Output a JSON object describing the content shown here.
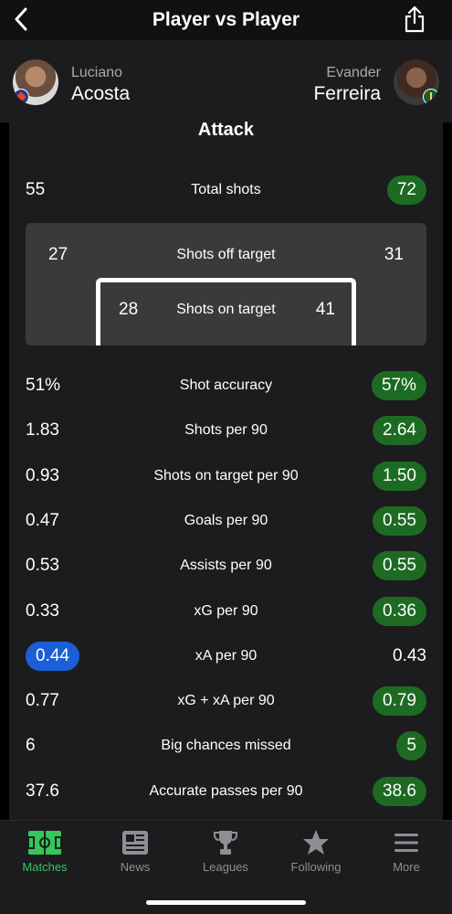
{
  "header": {
    "title": "Player vs Player"
  },
  "players": {
    "left": {
      "first": "Luciano",
      "last": "Acosta"
    },
    "right": {
      "first": "Evander",
      "last": "Ferreira"
    }
  },
  "section": {
    "title": "Attack"
  },
  "total_shots": {
    "label": "Total shots",
    "left": "55",
    "right": "72"
  },
  "shots_off_target": {
    "label": "Shots off target",
    "left": "27",
    "right": "31"
  },
  "shots_on_target": {
    "label": "Shots on target",
    "left": "28",
    "right": "41"
  },
  "stats": [
    {
      "label": "Shot accuracy",
      "left": "51%",
      "right": "57%",
      "highlight": "right"
    },
    {
      "label": "Shots per 90",
      "left": "1.83",
      "right": "2.64",
      "highlight": "right"
    },
    {
      "label": "Shots on target per 90",
      "left": "0.93",
      "right": "1.50",
      "highlight": "right"
    },
    {
      "label": "Goals per 90",
      "left": "0.47",
      "right": "0.55",
      "highlight": "right"
    },
    {
      "label": "Assists per 90",
      "left": "0.53",
      "right": "0.55",
      "highlight": "right"
    },
    {
      "label": "xG per 90",
      "left": "0.33",
      "right": "0.36",
      "highlight": "right"
    },
    {
      "label": "xA per 90",
      "left": "0.44",
      "right": "0.43",
      "highlight": "left"
    },
    {
      "label": "xG + xA per 90",
      "left": "0.77",
      "right": "0.79",
      "highlight": "right"
    },
    {
      "label": "Big chances missed",
      "left": "6",
      "right": "5",
      "highlight": "right"
    },
    {
      "label": "Accurate passes per 90",
      "left": "37.6",
      "right": "38.6",
      "highlight": "right"
    }
  ],
  "colors": {
    "left_highlight": "#1a5fd6",
    "right_highlight": "#1d6b22",
    "active_tab": "#34c759"
  },
  "tabbar": {
    "items": [
      {
        "label": "Matches",
        "icon": "pitch-icon",
        "active": true
      },
      {
        "label": "News",
        "icon": "newspaper-icon",
        "active": false
      },
      {
        "label": "Leagues",
        "icon": "trophy-icon",
        "active": false
      },
      {
        "label": "Following",
        "icon": "star-icon",
        "active": false
      },
      {
        "label": "More",
        "icon": "menu-icon",
        "active": false
      }
    ]
  }
}
